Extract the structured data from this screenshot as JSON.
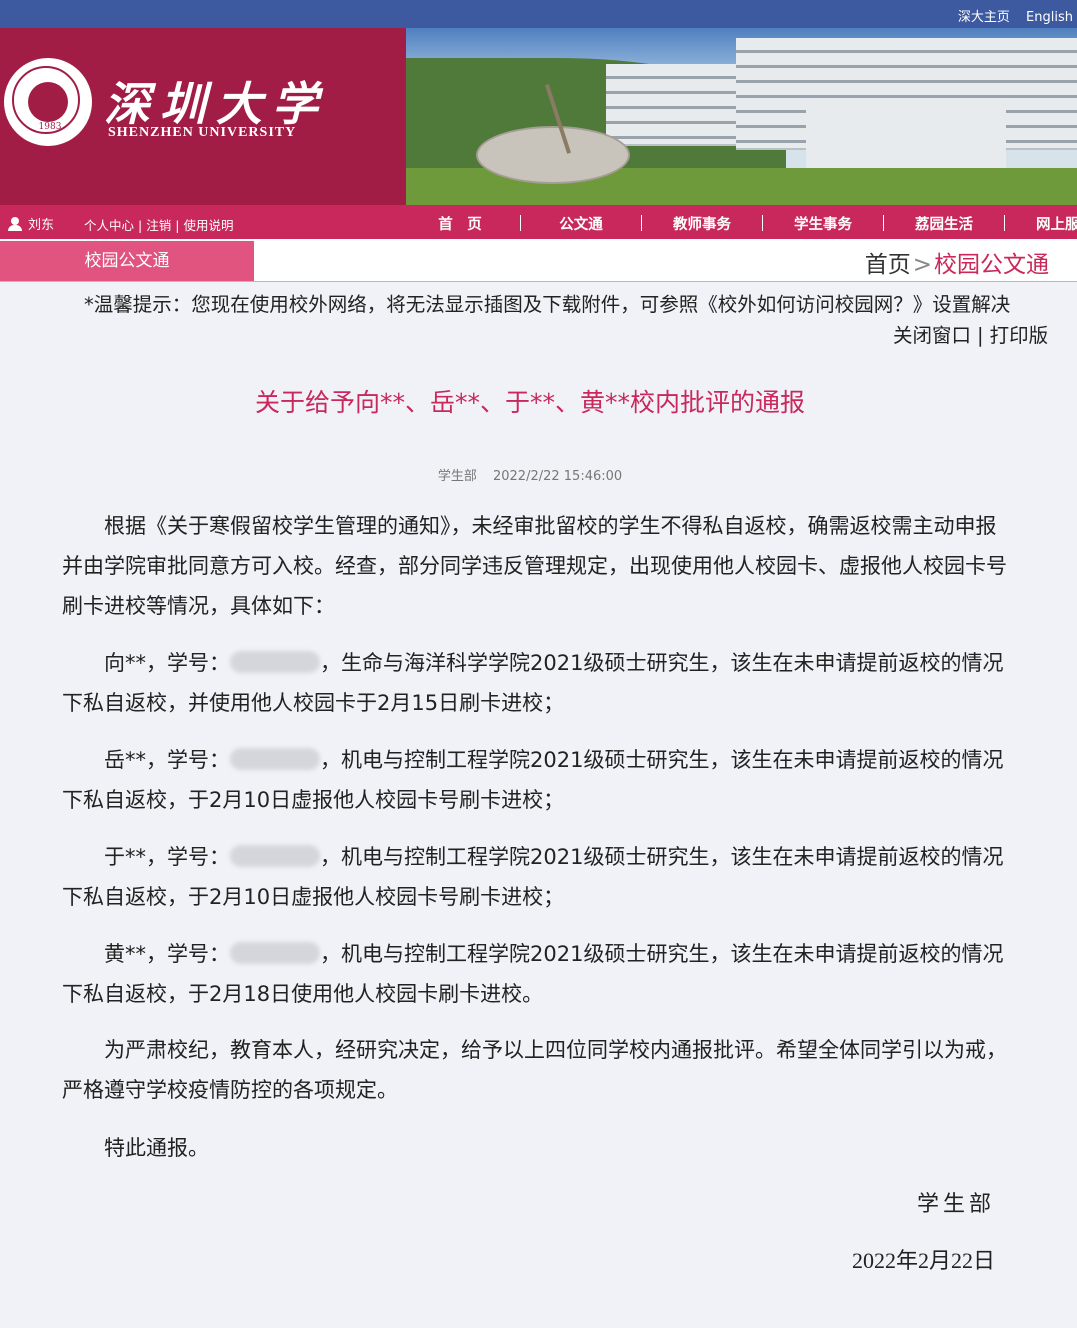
{
  "topbar": {
    "home_link": "深大主页",
    "english_link": "English"
  },
  "brand": {
    "cn_name": "深圳大学",
    "en_name": "SHENZHEN UNIVERSITY",
    "seal_year": "1983"
  },
  "nav": {
    "user_name": "刘东",
    "user_links": [
      "个人中心",
      "注销",
      "使用说明"
    ],
    "menu": [
      "首　页",
      "公文通",
      "教师事务",
      "学生事务",
      "荔园生活",
      "网上服务"
    ]
  },
  "breadcrumb": {
    "tab": "校园公文通",
    "home": "首页",
    "separator": ">",
    "current": "校园公文通"
  },
  "notice": {
    "text": "*温馨提示：您现在使用校外网络，将无法显示插图及下载附件，可参照《校外如何访问校园网？》设置解决",
    "close_window": "关闭窗口",
    "print": "打印版"
  },
  "article": {
    "title": "关于给予向**、岳**、于**、黄**校内批评的通报",
    "source": "学生部",
    "timestamp": "2022/2/22 15:46:00",
    "p1": "根据《关于寒假留校学生管理的通知》，未经审批留校的学生不得私自返校，确需返校需主动申报并由学院审批同意方可入校。经查，部分同学违反管理规定，出现使用他人校园卡、虚报他人校园卡号刷卡进校等情况，具体如下：",
    "s1_a": "向**，学号：",
    "s1_b": "，生命与海洋科学学院2021级硕士研究生，该生在未申请提前返校的情况下私自返校，并使用他人校园卡于2月15日刷卡进校；",
    "s2_a": "岳**，学号：",
    "s2_b": "，机电与控制工程学院2021级硕士研究生，该生在未申请提前返校的情况下私自返校，于2月10日虚报他人校园卡号刷卡进校；",
    "s3_a": "于**，学号：",
    "s3_b": "，机电与控制工程学院2021级硕士研究生，该生在未申请提前返校的情况下私自返校，于2月10日虚报他人校园卡号刷卡进校；",
    "s4_a": "黄**，学号：",
    "s4_b": "，机电与控制工程学院2021级硕士研究生，该生在未申请提前返校的情况下私自返校，于2月18日使用他人校园卡刷卡进校。",
    "p6": "为严肃校纪，教育本人，经研究决定，给予以上四位同学校内通报批评。希望全体同学引以为戒，严格遵守学校疫情防控的各项规定。",
    "p7": "特此通报。",
    "signature": "学生部",
    "date": "2022年2月22日"
  }
}
